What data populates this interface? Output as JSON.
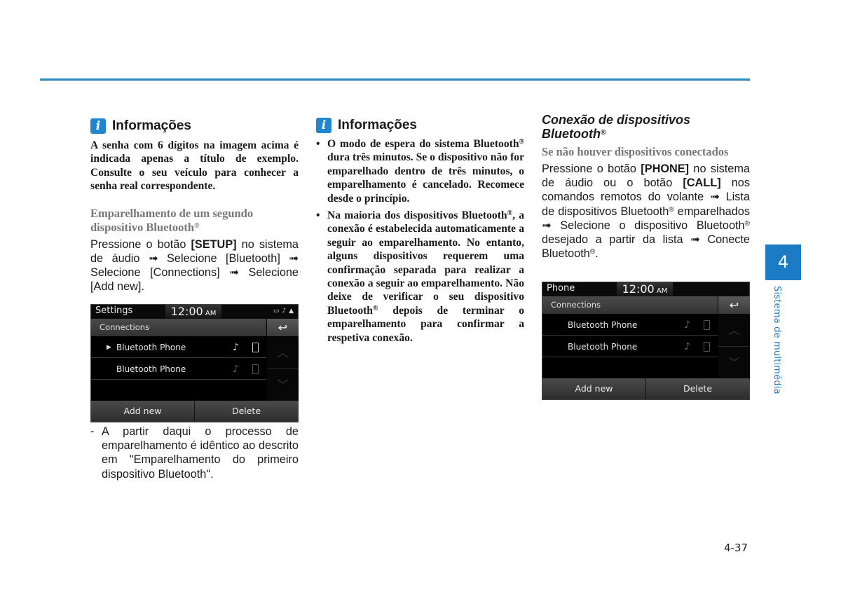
{
  "page": {
    "page_number": "4-37",
    "chapter_number": "4",
    "chapter_title": "Sistema de multimédia",
    "accent_color": "#1b7cc5"
  },
  "col1": {
    "info_icon": "info-icon",
    "info_title": "Informações",
    "info_text": "A senha com 6 dígitos na imagem acima é indicada apenas a título de exemplo. Consulte o seu veículo para conhecer a senha real correspondente.",
    "section_heading": "Emparelhamento de um segundo dispositivo Bluetooth",
    "section_heading_mark": "®",
    "instr_1": "Pressione o botão ",
    "instr_key": "[SETUP]",
    "instr_2": " no sistema de áudio ➟ Selecione [Bluetooth] ➟ Selecione [Connections] ➟ Selecione [Add new].",
    "note_dash": "-",
    "note_text": "A partir daqui o processo de emparelhamento é idêntico ao descrito em \"Emparelhamento do primeiro dispositivo Bluetooth\".",
    "screen": {
      "title": "Settings",
      "clock": "12:00",
      "clock_suffix": "AM",
      "status_icons": [
        "battery-icon",
        "bluetooth-audio-icon",
        "signal-icon"
      ],
      "subtitle": "Connections",
      "back_icon": "back-icon",
      "rows": [
        {
          "name": "Bluetooth Phone",
          "selected": true,
          "active": true
        },
        {
          "name": "Bluetooth Phone",
          "selected": false,
          "active": false
        }
      ],
      "scroll_up_icon": "chevron-up-icon",
      "scroll_down_icon": "chevron-down-icon",
      "buttons": [
        "Add new",
        "Delete"
      ]
    }
  },
  "col2": {
    "info_title": "Informações",
    "bullet_1_a": "O modo de espera do sistema Bluetooth",
    "bullet_1_b": " dura três minutos. Se o dispositivo não for emparelhado dentro de três minutos, o emparelhamento é cancelado. Recomece desde o princípio.",
    "bullet_2_a": "Na maioria dos dispositivos Bluetooth",
    "bullet_2_b": ", a conexão é estabelecida automaticamente a seguir ao emparelhamento. No entanto, alguns dispositivos requerem uma confirmação separada para realizar a conexão a seguir ao emparelhamento. Não deixe de verificar o seu dispositivo Bluetooth",
    "bullet_2_c": " depois de terminar o emparelhamento para confirmar a respetiva conexão.",
    "reg_mark": "®",
    "bullet_char": "•"
  },
  "col3": {
    "heading_line1": "Conexão de dispositivos",
    "heading_line2": "Bluetooth",
    "heading_mark": "®",
    "subheading": "Se não houver dispositivos conectados",
    "p_1": "Pressione o botão ",
    "p_key1": "[PHONE]",
    "p_2": " no sistema de áudio ou o botão ",
    "p_key2": "[CALL]",
    "p_3": " nos comandos remotos do volante ➟ Lista de dispositivos Bluetooth",
    "p_mark": "®",
    "p_4": " emparelhados ➟ Selecione o dispositivo Bluetooth",
    "p_5": " desejado a partir da lista ➟ Conecte Bluetooth",
    "p_6": ".",
    "screen": {
      "title": "Phone",
      "clock": "12:00",
      "clock_suffix": "AM",
      "subtitle": "Connections",
      "back_icon": "back-icon",
      "rows": [
        {
          "name": "Bluetooth Phone"
        },
        {
          "name": "Bluetooth Phone"
        }
      ],
      "buttons": [
        "Add new",
        "Delete"
      ]
    }
  }
}
